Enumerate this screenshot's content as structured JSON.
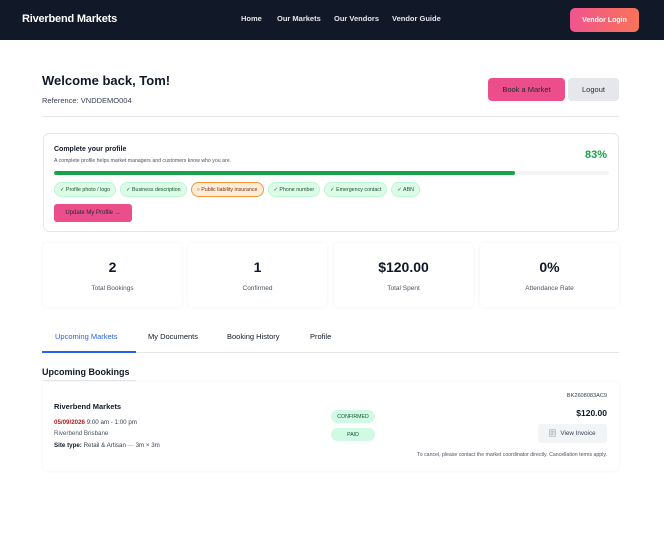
{
  "nav": {
    "brand": "Riverbend Markets",
    "links": [
      "Home",
      "Our Markets",
      "Our Vendors",
      "Vendor Guide"
    ],
    "vendor_login": "Vendor Login"
  },
  "header": {
    "welcome": "Welcome back, Tom!",
    "reference_label": "Reference:",
    "reference": "VNDDEMO004",
    "book_label": "Book a Market",
    "logout_label": "Logout"
  },
  "profile": {
    "title": "Complete your profile",
    "subtitle": "A complete profile helps market managers and customers know who you are.",
    "percent": "83%",
    "progress": 0.83,
    "chips": [
      {
        "label": "✓ Profile photo / logo",
        "done": true
      },
      {
        "label": "✓ Business description",
        "done": true
      },
      {
        "label": "○ Public liability insurance",
        "done": false
      },
      {
        "label": "✓ Phone number",
        "done": true
      },
      {
        "label": "✓ Emergency contact",
        "done": true
      },
      {
        "label": "✓ ABN",
        "done": true
      }
    ],
    "update_label": "Update My Profile →"
  },
  "stats": [
    {
      "value": "2",
      "label": "Total Bookings"
    },
    {
      "value": "1",
      "label": "Confirmed"
    },
    {
      "value": "$120.00",
      "label": "Total Spent"
    },
    {
      "value": "0%",
      "label": "Attendance Rate"
    }
  ],
  "tabs": [
    "Upcoming Markets",
    "My Documents",
    "Booking History",
    "Profile"
  ],
  "bookings": {
    "section_title": "Upcoming Bookings",
    "items": [
      {
        "market": "Riverbend Markets",
        "date": "05/09/2026",
        "time": "9:00 am - 1:00 pm",
        "location": "Riverbend Brisbane",
        "site_label": "Site type:",
        "site_type": "Retail & Artisan",
        "site_size": "3m × 3m",
        "status": "CONFIRMED",
        "payment": "PAID",
        "reference": "BK2608083AC9",
        "price": "$120.00",
        "invoice_label": "View Invoice",
        "note": "To cancel, please contact the market coordinator directly. Cancellation terms apply."
      }
    ]
  }
}
